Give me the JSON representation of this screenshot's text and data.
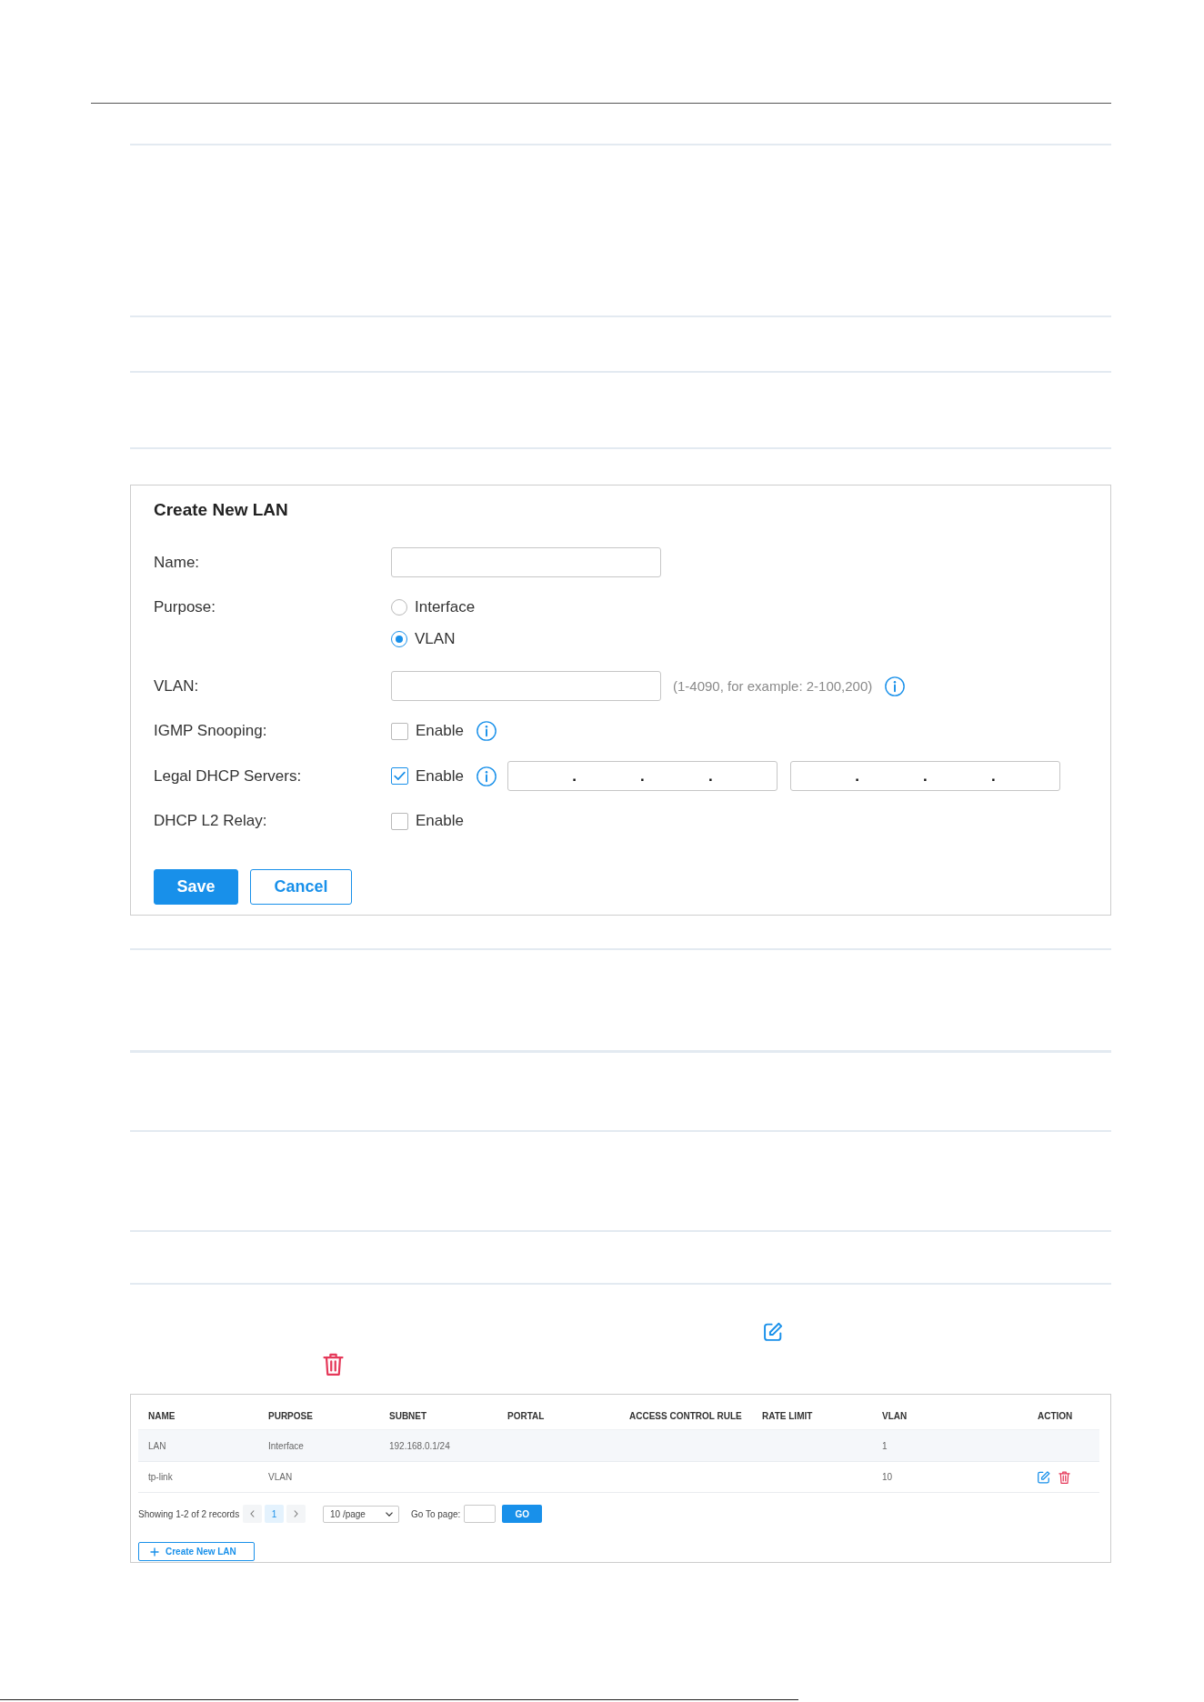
{
  "form": {
    "title": "Create New LAN",
    "fields": [
      {
        "kind": "text",
        "label": "Name:"
      },
      {
        "kind": "radio",
        "label": "Purpose:",
        "options": [
          {
            "label": "Interface",
            "selected": false
          },
          {
            "label": "VLAN",
            "selected": true
          }
        ]
      },
      {
        "kind": "text",
        "label": "VLAN:",
        "hint": "(1-4090, for example: 2-100,200)",
        "info": true
      },
      {
        "kind": "checkbox",
        "label": "IGMP Snooping:",
        "option": "Enable",
        "checked": false,
        "info": true
      },
      {
        "kind": "checkbox",
        "label": "Legal DHCP Servers:",
        "option": "Enable",
        "checked": true,
        "info": true,
        "ip_fields": [
          {
            "separators": [
              ".",
              ".",
              "."
            ]
          },
          {
            "separators": [
              ".",
              ".",
              "."
            ]
          }
        ]
      },
      {
        "kind": "checkbox",
        "label": "DHCP L2 Relay:",
        "option": "Enable",
        "checked": false
      }
    ],
    "buttons": [
      {
        "kind": "save",
        "label": "Save"
      },
      {
        "kind": "cancel",
        "label": "Cancel"
      }
    ]
  },
  "document_icons": [
    {
      "kind": "edit"
    },
    {
      "kind": "delete"
    }
  ],
  "table": {
    "columns": [
      "NAME",
      "PURPOSE",
      "SUBNET",
      "PORTAL",
      "ACCESS CONTROL RULE",
      "RATE LIMIT",
      "VLAN",
      "ACTION"
    ],
    "rows": [
      {
        "highlighted": true,
        "name": "LAN",
        "purpose": "Interface",
        "subnet": "192.168.0.1/24",
        "vlan": "1"
      },
      {
        "highlighted": false,
        "name": "tp-link",
        "purpose": "VLAN",
        "vlan": "10",
        "actions": [
          {
            "kind": "edit"
          },
          {
            "kind": "delete"
          }
        ]
      }
    ],
    "pagination": {
      "summary": "Showing 1-2 of 2 records",
      "pages": [
        {
          "label": "1",
          "selected": true
        }
      ],
      "page_size": "10 /page",
      "goto_label": "Go To page:",
      "go_button": "GO"
    },
    "create_button": "Create New LAN"
  }
}
